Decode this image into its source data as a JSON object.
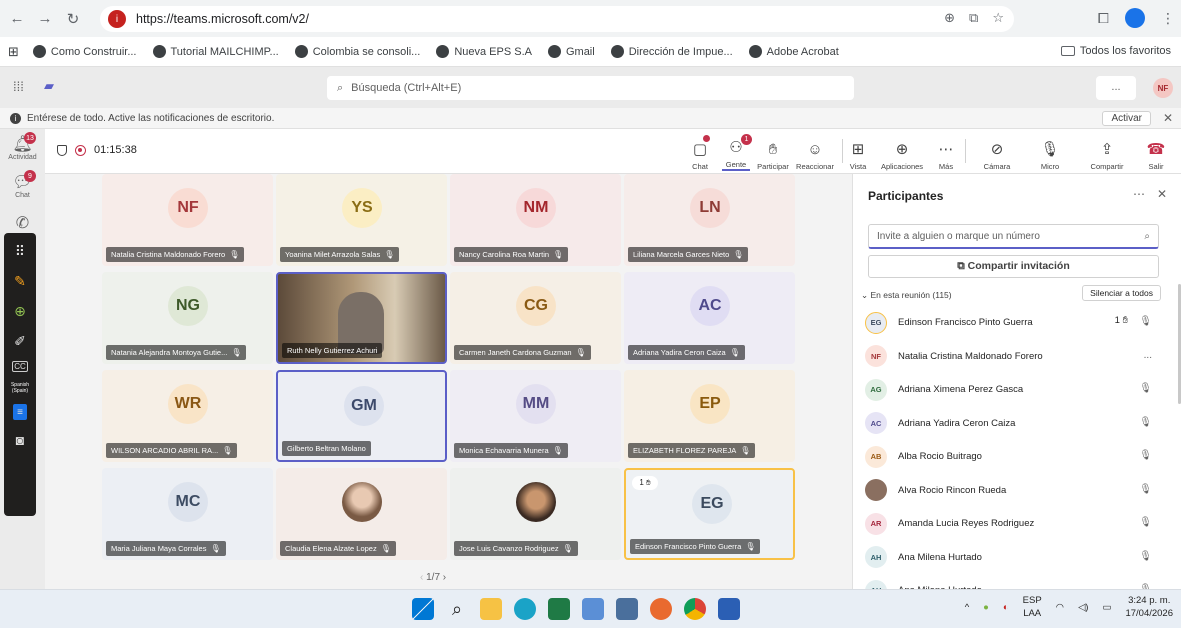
{
  "browser": {
    "url": "https://teams.microsoft.com/v2/",
    "bookmarks": [
      "Como Construir...",
      "Tutorial MAILCHIMP...",
      "Colombia se consoli...",
      "Nueva EPS S.A",
      "Gmail",
      "Dirección de Impue...",
      "Adobe Acrobat"
    ],
    "all_bookmarks": "Todos los favoritos"
  },
  "teams": {
    "search_placeholder": "Búsqueda (Ctrl+Alt+E)",
    "more": "...",
    "user_initials": "NF",
    "notification": "Entérese de todo. Active las notificaciones de escritorio.",
    "activate_label": "Activar"
  },
  "rail": {
    "activity_label": "Actividad",
    "activity_count": "13",
    "chat_label": "Chat",
    "chat_count": "9"
  },
  "meeting": {
    "timer": "01:15:38",
    "toolbar": {
      "chat": "Chat",
      "people": "Gente",
      "people_count": "1",
      "raise": "Participar",
      "react": "Reaccionar",
      "view": "Vista",
      "apps": "Aplicaciones",
      "more": "Más",
      "camera": "Cámara",
      "mic": "Micro",
      "share": "Compartir",
      "leave": "Salir"
    },
    "tiles": [
      {
        "initials": "NF",
        "name": "Natalia Cristina Maldonado Forero",
        "bg": "#f7ece9",
        "av": "#f9dcd3",
        "fg": "#a4373a"
      },
      {
        "initials": "YS",
        "name": "Yoanina Milet Arrazola Salas",
        "bg": "#f5f1e6",
        "av": "#fbeec4",
        "fg": "#8a6d14"
      },
      {
        "initials": "NM",
        "name": "Nancy Carolina Roa Martin",
        "bg": "#f6eaea",
        "av": "#f7d9d9",
        "fg": "#a4262c"
      },
      {
        "initials": "LN",
        "name": "Liliana Marcela Garces Nieto",
        "bg": "#f6ecea",
        "av": "#f6dcd8",
        "fg": "#8e3b35"
      },
      {
        "initials": "NG",
        "name": "Natania Alejandra Montoya Gutie...",
        "bg": "#eef1ec",
        "av": "#dfe8d6",
        "fg": "#3e5a2a"
      },
      {
        "initials": "",
        "name": "Ruth Nelly Gutierrez Achuri",
        "bg": "#8a7a68",
        "av": "",
        "fg": ""
      },
      {
        "initials": "CG",
        "name": "Carmen Janeth Cardona Guzman",
        "bg": "#f5efe6",
        "av": "#f8e3c7",
        "fg": "#8a5a14"
      },
      {
        "initials": "AC",
        "name": "Adriana Yadira Ceron Caiza",
        "bg": "#eeecf5",
        "av": "#e0ddf3",
        "fg": "#4f4a8c"
      },
      {
        "initials": "WR",
        "name": "WILSON ARCADIO ABRIL RA...",
        "bg": "#f6efe6",
        "av": "#f9e4c7",
        "fg": "#8a5714"
      },
      {
        "initials": "GM",
        "name": "Gilberto Beltran Molano",
        "bg": "#eceef4",
        "av": "#dde2ee",
        "fg": "#3d4a6b"
      },
      {
        "initials": "MM",
        "name": "Monica Echavarria Munera",
        "bg": "#efedf4",
        "av": "#e3e0f0",
        "fg": "#554c85"
      },
      {
        "initials": "EP",
        "name": "ELIZABETH FLOREZ PAREJA",
        "bg": "#f6efe4",
        "av": "#f9e5c4",
        "fg": "#8a5a0d"
      },
      {
        "initials": "MC",
        "name": "Maria Juliana Maya Corrales",
        "bg": "#eceff4",
        "av": "#dde3ed",
        "fg": "#3d4c63"
      },
      {
        "initials": "",
        "name": "Claudia Elena Alzate Lopez",
        "bg": "#f4ece8",
        "av": "",
        "fg": ""
      },
      {
        "initials": "",
        "name": "Jose Luis Cavanzo Rodriguez",
        "bg": "#eef0ee",
        "av": "",
        "fg": ""
      },
      {
        "initials": "EG",
        "name": "Edinson Francisco Pinto Guerra",
        "bg": "#eef1f4",
        "av": "#dfe6ee",
        "fg": "#3b4a5e"
      }
    ],
    "hand_count": "1",
    "pager": "1/7"
  },
  "participants": {
    "title": "Participantes",
    "invite_placeholder": "Invite a alguien o marque un número",
    "share_invite": "Compartir invitación",
    "in_meeting": "En esta reunión (115)",
    "mute_all": "Silenciar a todos",
    "list": [
      {
        "initials": "EG",
        "name": "Edinson Francisco Pinto Guerra",
        "bg": "#e8ecf3",
        "fg": "#3b4a5e",
        "hand": "1"
      },
      {
        "initials": "NF",
        "name": "Natalia Cristina Maldonado Forero",
        "bg": "#fbe2dc",
        "fg": "#a4373a",
        "more": "..."
      },
      {
        "initials": "AG",
        "name": "Adriana Ximena Perez Gasca",
        "bg": "#e2efe5",
        "fg": "#2f6b3d"
      },
      {
        "initials": "AC",
        "name": "Adriana Yadira Ceron Caiza",
        "bg": "#e6e4f5",
        "fg": "#4f4a8c"
      },
      {
        "initials": "AB",
        "name": "Alba Rocio Buitrago",
        "bg": "#fbe9d9",
        "fg": "#9a5a14"
      },
      {
        "initials": "",
        "name": "Alva Rocio Rincon Rueda",
        "bg": "#8a6f60",
        "fg": "#ffffff"
      },
      {
        "initials": "AR",
        "name": "Amanda Lucia Reyes Rodriguez",
        "bg": "#f8e1e6",
        "fg": "#a4263c"
      },
      {
        "initials": "AH",
        "name": "Ana Milena Hurtado",
        "bg": "#e2eef0",
        "fg": "#2f5f6b"
      },
      {
        "initials": "AH",
        "name": "Ana Milena Hurtado",
        "bg": "#e2eef0",
        "fg": "#2f5f6b"
      }
    ]
  },
  "taskbar": {
    "lang_top": "ESP",
    "lang_bottom": "LAA",
    "time": "3:24 p. m.",
    "date": "17/04/2026"
  }
}
